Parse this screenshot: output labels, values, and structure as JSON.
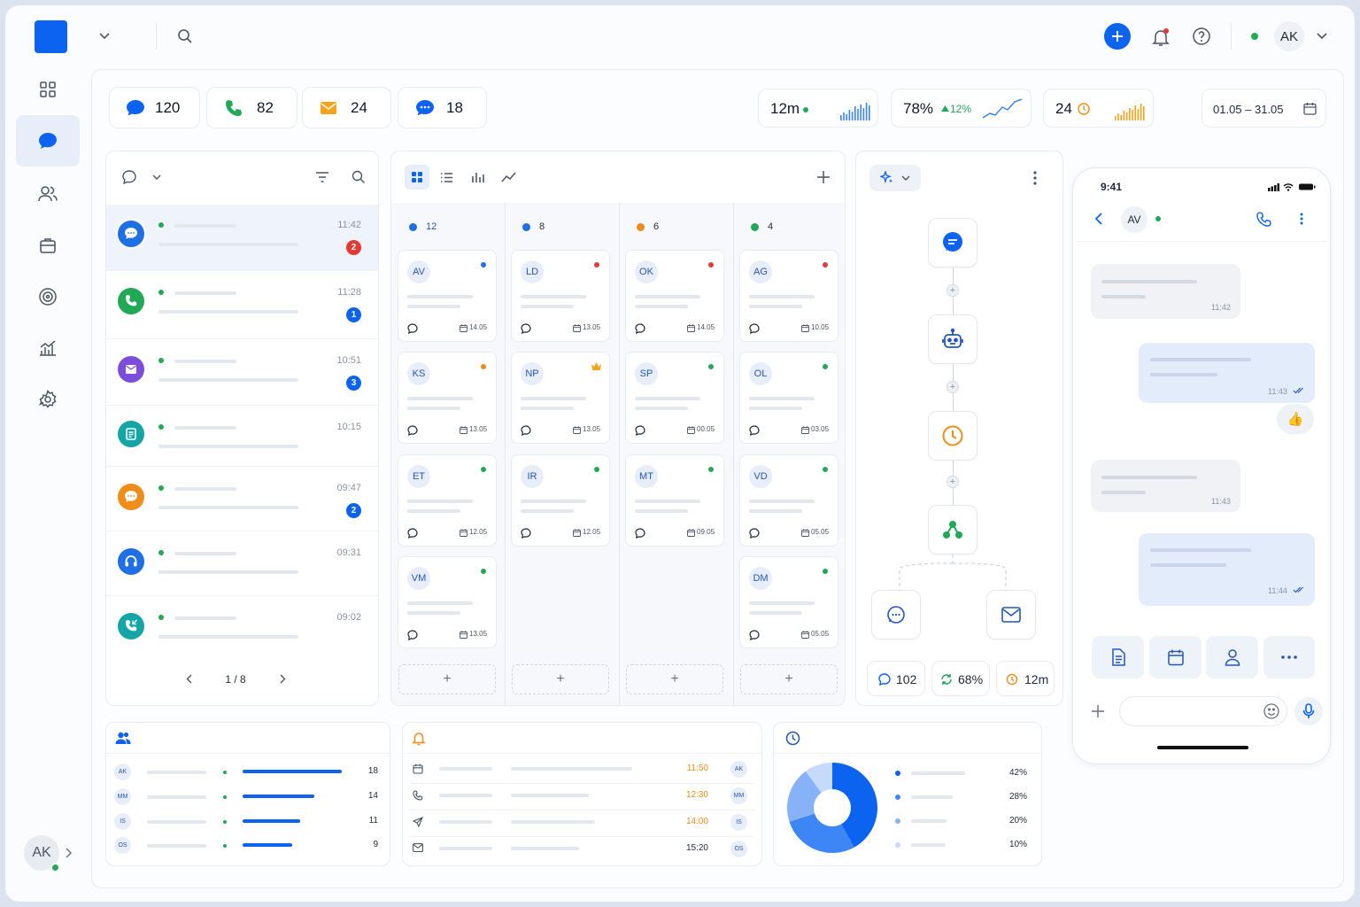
{
  "topbar": {
    "user_initials": "AK"
  },
  "stats": {
    "chats": "120",
    "calls": "82",
    "emails": "24",
    "messages": "18",
    "time": "12m",
    "percent": "78%",
    "percent_change": "12%",
    "pending": "24",
    "date_range": "01.05 – 31.05"
  },
  "inbox": {
    "items": [
      {
        "time": "11:42",
        "badge": "2",
        "icon": "chat-icon"
      },
      {
        "time": "11:28",
        "badge": "1",
        "icon": "phone-icon"
      },
      {
        "time": "10:51",
        "badge": "3",
        "icon": "mail-icon"
      },
      {
        "time": "10:15",
        "badge": "",
        "icon": "document-icon"
      },
      {
        "time": "09:47",
        "badge": "2",
        "icon": "chat-dots-icon"
      },
      {
        "time": "09:31",
        "badge": "",
        "icon": "headset-icon"
      },
      {
        "time": "09:02",
        "badge": "",
        "icon": "phone-incoming-icon"
      }
    ],
    "pagination": "1 / 8"
  },
  "kanban": {
    "columns": [
      {
        "count": "12",
        "color": "#1f6fe5",
        "cards": [
          {
            "initials": "AV",
            "date": "14.05",
            "dot": "#1f6fe5"
          },
          {
            "initials": "KS",
            "date": "13.05",
            "dot": "#f08c1a"
          },
          {
            "initials": "ET",
            "date": "12.05",
            "dot": "#22a957"
          },
          {
            "initials": "VM",
            "date": "13.05",
            "dot": "#22a957"
          }
        ]
      },
      {
        "count": "8",
        "color": "#1f6fe5",
        "cards": [
          {
            "initials": "LD",
            "date": "13.05",
            "dot": "#e53935"
          },
          {
            "initials": "NP",
            "date": "13.05",
            "dot": "crown"
          },
          {
            "initials": "IR",
            "date": "12.05",
            "dot": "#22a957"
          }
        ]
      },
      {
        "count": "6",
        "color": "#f08c1a",
        "cards": [
          {
            "initials": "OK",
            "date": "14.05",
            "dot": "#e53935"
          },
          {
            "initials": "SP",
            "date": "00.05",
            "dot": "#22a957"
          },
          {
            "initials": "MT",
            "date": "09.05",
            "dot": "#22a957"
          }
        ]
      },
      {
        "count": "4",
        "color": "#22a957",
        "cards": [
          {
            "initials": "AG",
            "date": "10.05",
            "dot": "#e53935"
          },
          {
            "initials": "OL",
            "date": "03.05",
            "dot": "#22a957"
          },
          {
            "initials": "VD",
            "date": "05.05",
            "dot": "#22a957"
          },
          {
            "initials": "DM",
            "date": "05.05",
            "dot": "#22a957"
          }
        ]
      }
    ]
  },
  "flow": {
    "stat_chats": "102",
    "stat_rate": "68%",
    "stat_time": "12m"
  },
  "phone": {
    "clock": "9:41",
    "contact": "AV",
    "messages": [
      {
        "time": "11:42",
        "side": "in"
      },
      {
        "time": "11:43",
        "side": "out"
      },
      {
        "time": "11:43",
        "side": "in"
      },
      {
        "time": "11:44",
        "side": "out"
      }
    ]
  },
  "team": {
    "rows": [
      {
        "initials": "AK",
        "value": "18",
        "fill": 1.0
      },
      {
        "initials": "MM",
        "value": "14",
        "fill": 0.72
      },
      {
        "initials": "IS",
        "value": "11",
        "fill": 0.58
      },
      {
        "initials": "OS",
        "value": "9",
        "fill": 0.5
      }
    ]
  },
  "schedule": {
    "rows": [
      {
        "icon": "calendar-icon",
        "time": "11:50",
        "initials": "AK",
        "accent": true
      },
      {
        "icon": "phone-icon",
        "time": "12:30",
        "initials": "MM",
        "accent": true
      },
      {
        "icon": "send-icon",
        "time": "14:00",
        "initials": "IS",
        "accent": true
      },
      {
        "icon": "mail-icon",
        "time": "15:20",
        "initials": "OS",
        "accent": false
      }
    ]
  },
  "chart_data": {
    "type": "pie",
    "values": [
      42,
      28,
      20,
      10
    ],
    "labels": [
      "42%",
      "28%",
      "20%",
      "10%"
    ],
    "colors": [
      "#0b63f0",
      "#3d86f5",
      "#87b2f8",
      "#c6dafb"
    ]
  }
}
